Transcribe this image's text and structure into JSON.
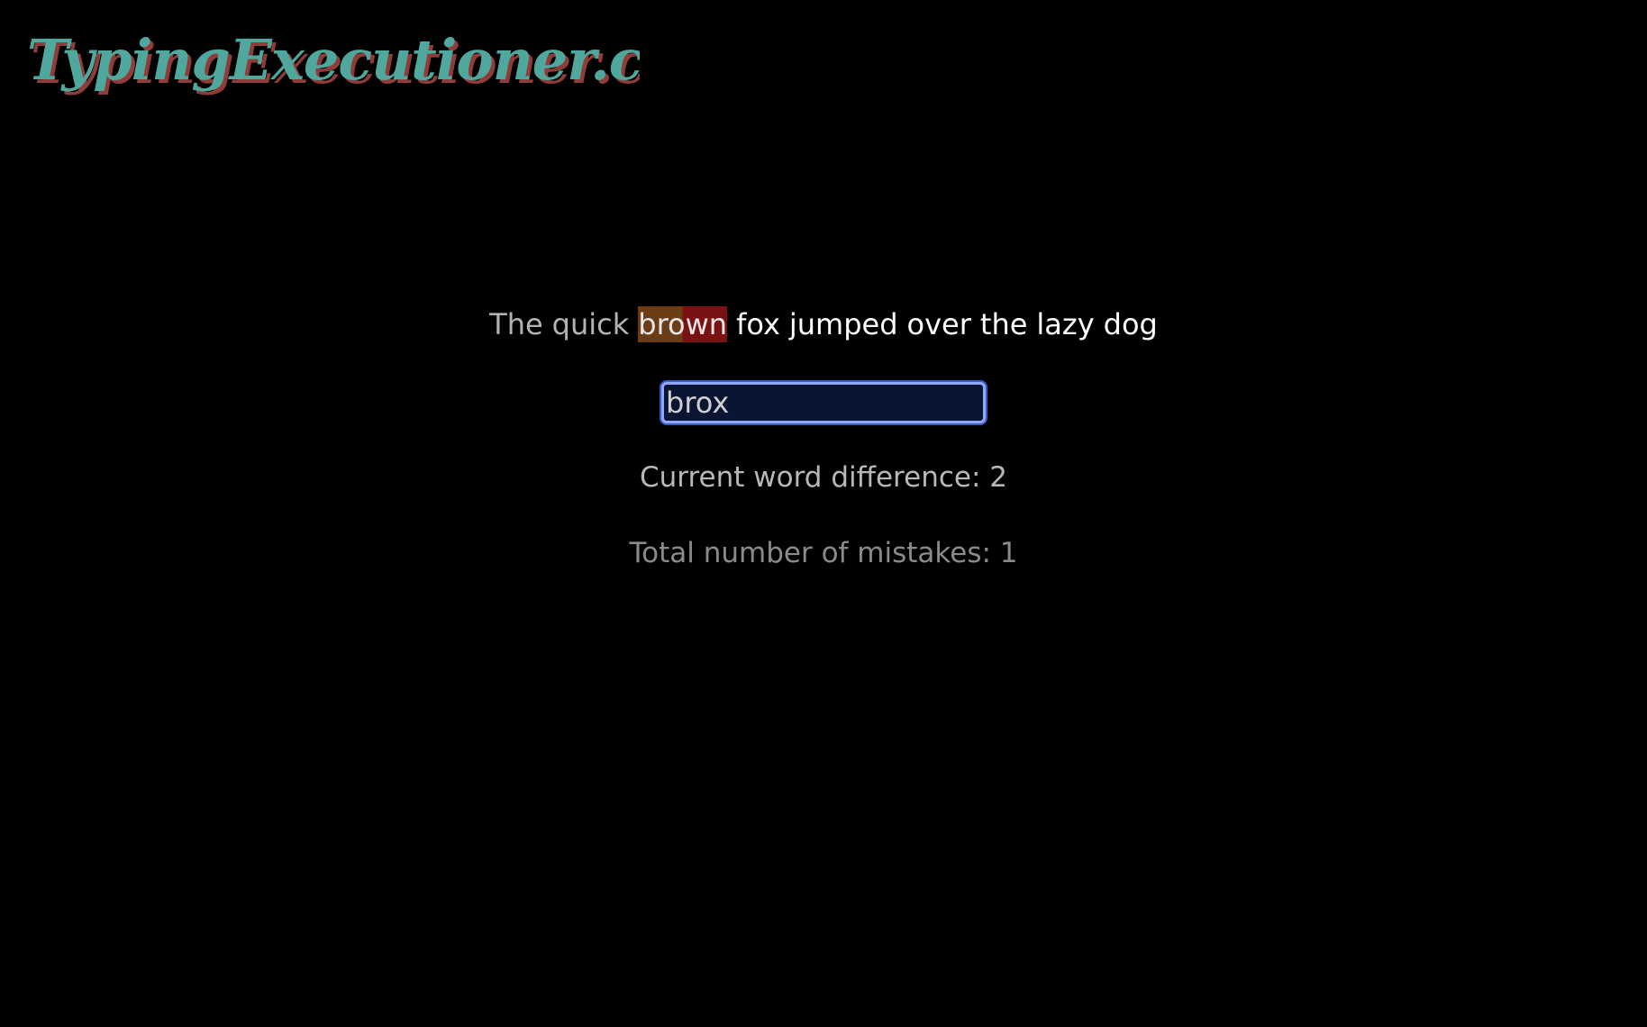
{
  "logo": {
    "text": "TypingExecutioner.com",
    "color_primary": "#4fa79d",
    "color_shadow": "#c0504d"
  },
  "sentence": {
    "words": [
      {
        "text": "The",
        "state": "done"
      },
      {
        "text": "quick",
        "state": "done"
      },
      {
        "text": "brown",
        "state": "current"
      },
      {
        "text": "fox",
        "state": "pending"
      },
      {
        "text": "jumped",
        "state": "pending"
      },
      {
        "text": "over",
        "state": "pending"
      },
      {
        "text": "the",
        "state": "pending"
      },
      {
        "text": "lazy",
        "state": "pending"
      },
      {
        "text": "dog",
        "state": "pending"
      }
    ]
  },
  "input": {
    "value": "brox"
  },
  "stats": {
    "word_difference_label": "Current word difference: 2",
    "mistakes_label": "Total number of mistakes: 1"
  },
  "colors": {
    "current_word_correct_bg": "#6b3d16",
    "current_word_error_bg": "#7a1212",
    "input_border": "#8fa8ff"
  }
}
